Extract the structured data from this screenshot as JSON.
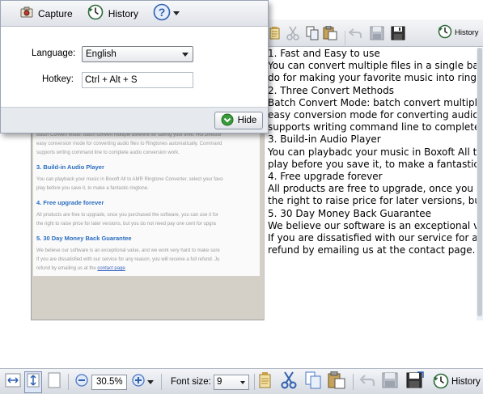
{
  "popup": {
    "toolbar": {
      "capture_label": "Capture",
      "history_label": "History"
    },
    "language_label": "Language:",
    "language_value": "English",
    "hotkey_label": "Hotkey:",
    "hotkey_value": "Ctrl + Alt + S",
    "hide_label": "Hide"
  },
  "preview": {
    "lines": [
      "Batch Convert Mode: batch convert multiple different for saving your time. Hot Director",
      "easy conversion mode for converting audio files to Ringtones automatically. Command",
      "supports writing command line to complete audio conversion work."
    ],
    "heading3": "3. Build-in Audio Player",
    "para3": [
      "You can playback your music in Boxoft All to AMR Ringtone Converter, select your favo",
      "play before you save it, to make a fantastic ringtone."
    ],
    "heading4": "4. Free upgrade forever",
    "para4": [
      "All products are free to upgrade, once you purchased the software, you can use it for",
      "the right to raise price for later versions, but you do not need pay one cent for upgra"
    ],
    "heading5": "5. 30 Day Money Back Guarantee",
    "para5": [
      "We believe our software is an exceptional value, and we work very hard to make sure",
      "If you are dissatisfied with our service for any reason, you will receive a full refund. Ju"
    ],
    "para5_last_prefix": "refund by emailing us at the ",
    "para5_link": "contact page",
    "para5_last_suffix": "."
  },
  "text_pane": {
    "history_label": "History",
    "lines": [
      "1. Fast and Easy to use",
      "You can convert multiple files in a single batch",
      "do for making your favorite music into ringtone",
      "2. Three Convert Methods",
      "Batch Convert Mode: batch convert multiple d",
      "easy conversion mode for converting audio fil",
      "supports writing command line to complete a",
      "3. Build-in Audio Player",
      "You can playbadc your music in Boxoft All to A",
      "play before you save it, to make a fantastic ri",
      "4. Free upgrade forever",
      "All products are free to upgrade, once you pu",
      "the right to raise price for later versions, but y",
      "5. 30 Day Money Back Guarantee",
      "We believe our software is an exceptional val",
      "If you are dissatisfied with our service for any",
      "refund by emailing us at the contact page."
    ]
  },
  "bottom_toolbar": {
    "zoom_value": "30.5%",
    "font_size_label": "Font size:",
    "font_size_value": "9",
    "history_label": "History"
  },
  "colors": {
    "accent_blue": "#2b6dbf",
    "green_arrow": "#3a9a3a",
    "cut_blue": "#2f5fb0"
  }
}
